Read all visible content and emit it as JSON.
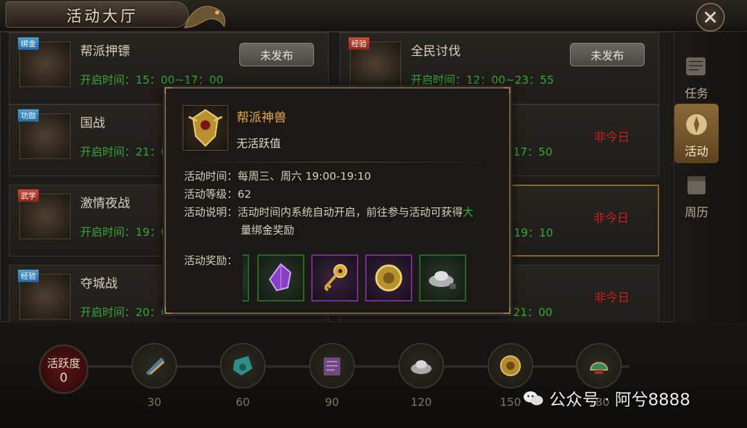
{
  "header": {
    "title": "活动大厅",
    "close_glyph": "✕"
  },
  "activities": [
    {
      "tag": "绑金",
      "tag_color": "blue",
      "name": "帮派押镖",
      "time": "开启时间：15：00~17：00",
      "action": "未发布"
    },
    {
      "tag": "经验",
      "tag_color": "red",
      "name": "全民讨伐",
      "time": "开启时间：12：00~23：55",
      "action": "未发布"
    },
    {
      "tag": "功勋",
      "tag_color": "blue",
      "name": "国战",
      "time": "开启时间：21：0",
      "status": ""
    },
    {
      "tag": "",
      "name": "",
      "time": "17：50",
      "status": "非今日"
    },
    {
      "tag": "武学",
      "tag_color": "red",
      "name": "激情夜战",
      "time": "开启时间：19：0",
      "status": ""
    },
    {
      "tag": "",
      "name": "",
      "time": "19：10",
      "status": "非今日"
    },
    {
      "tag": "经验",
      "tag_color": "blue",
      "name": "夺城战",
      "time": "开启时间：20：0",
      "status": ""
    },
    {
      "tag": "",
      "name": "",
      "time": "21：00",
      "status": "非今日"
    }
  ],
  "sidebar": {
    "tabs": [
      {
        "label": "任务"
      },
      {
        "label": "活动"
      },
      {
        "label": "周历"
      }
    ]
  },
  "activity_bar": {
    "label": "活跃度",
    "value": "0",
    "milestones": [
      "30",
      "60",
      "90",
      "120",
      "150",
      "180"
    ]
  },
  "popup": {
    "name": "帮派神兽",
    "subtitle": "无活跃值",
    "time_label": "活动时间：",
    "time_value": "每周三、周六 19:00-19:10",
    "level_label": "活动等级：",
    "level_value": "62",
    "desc_label": "活动说明：",
    "desc_value": "活动时间内系统自动开启，前往参与活动可获得",
    "desc_highlight_1": "大",
    "desc_highlight_2": "量绑金奖励",
    "reward_label": "活动奖励："
  },
  "watermark": {
    "text": "公众号 · 阿兮8888"
  }
}
